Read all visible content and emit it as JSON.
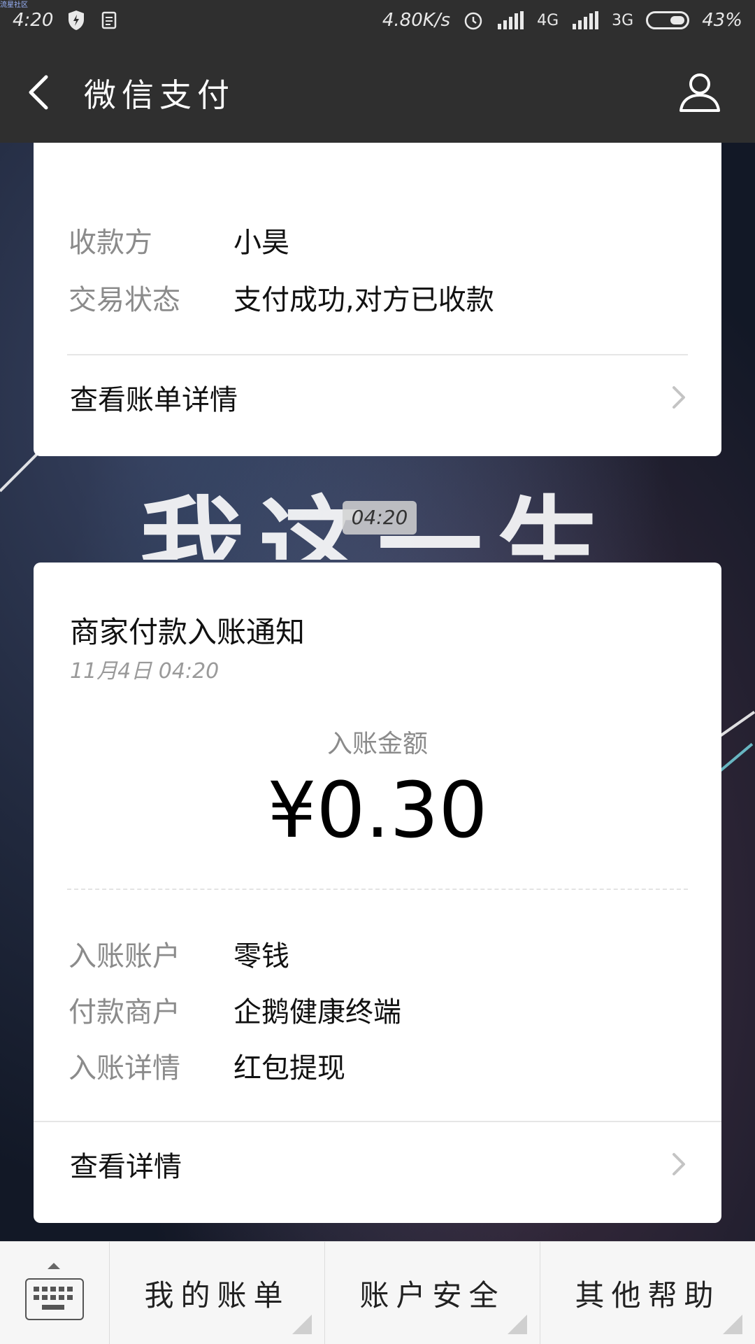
{
  "status_bar": {
    "tiny_label": "流星社区",
    "time": "4:20",
    "network_speed": "4.80K/s",
    "signal_1_label": "4G",
    "signal_2_label": "3G",
    "battery": "43%"
  },
  "nav": {
    "title": "微信支付"
  },
  "payment_card": {
    "payee_label": "收款方",
    "payee_value": "小昊",
    "status_label": "交易状态",
    "status_value": "支付成功,对方已收款",
    "link_label": "查看账单详情"
  },
  "background": {
    "big_text": "我这一生",
    "bubble_time": "04:20"
  },
  "notice_card": {
    "title": "商家付款入账通知",
    "datetime": "11月4日  04:20",
    "amount_label": "入账金额",
    "amount_value": "¥0.30",
    "rows": [
      {
        "label": "入账账户",
        "value": "零钱"
      },
      {
        "label": "付款商户",
        "value": "企鹅健康终端"
      },
      {
        "label": "入账详情",
        "value": "红包提现"
      }
    ],
    "link_label": "查看详情"
  },
  "bottom_menu": {
    "items": [
      "我的账单",
      "账户安全",
      "其他帮助"
    ]
  },
  "colors": {
    "header_bg": "#2f2f2f",
    "card_bg": "#ffffff",
    "label_gray": "#8b8b8b"
  }
}
